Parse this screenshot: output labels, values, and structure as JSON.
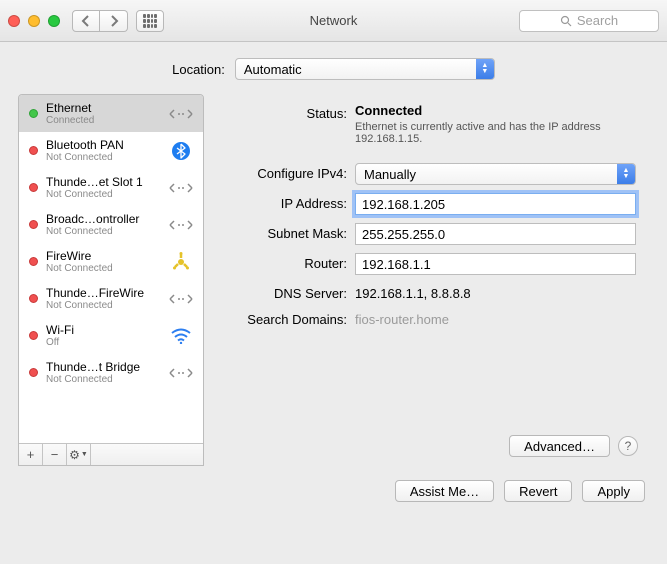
{
  "window": {
    "title": "Network",
    "search_placeholder": "Search"
  },
  "location": {
    "label": "Location:",
    "value": "Automatic"
  },
  "interfaces": [
    {
      "name": "Ethernet",
      "sub": "Connected",
      "dot": "green",
      "icon": "ethernet-icon",
      "selected": true
    },
    {
      "name": "Bluetooth PAN",
      "sub": "Not Connected",
      "dot": "red",
      "icon": "bluetooth-icon",
      "selected": false
    },
    {
      "name": "Thunde…et Slot 1",
      "sub": "Not Connected",
      "dot": "red",
      "icon": "ethernet-icon",
      "selected": false
    },
    {
      "name": "Broadc…ontroller",
      "sub": "Not Connected",
      "dot": "red",
      "icon": "ethernet-icon",
      "selected": false
    },
    {
      "name": "FireWire",
      "sub": "Not Connected",
      "dot": "red",
      "icon": "firewire-icon",
      "selected": false
    },
    {
      "name": "Thunde…FireWire",
      "sub": "Not Connected",
      "dot": "red",
      "icon": "ethernet-icon",
      "selected": false
    },
    {
      "name": "Wi-Fi",
      "sub": "Off",
      "dot": "red",
      "icon": "wifi-icon",
      "selected": false
    },
    {
      "name": "Thunde…t Bridge",
      "sub": "Not Connected",
      "dot": "red",
      "icon": "ethernet-icon",
      "selected": false
    }
  ],
  "detail": {
    "status_label": "Status:",
    "status_value": "Connected",
    "status_msg": "Ethernet is currently active and has the IP address 192.168.1.15.",
    "configure_label": "Configure IPv4:",
    "configure_value": "Manually",
    "ip_label": "IP Address:",
    "ip_value": "192.168.1.205",
    "mask_label": "Subnet Mask:",
    "mask_value": "255.255.255.0",
    "router_label": "Router:",
    "router_value": "192.168.1.1",
    "dns_label": "DNS Server:",
    "dns_value": "192.168.1.1, 8.8.8.8",
    "search_label": "Search Domains:",
    "search_value": "fios-router.home",
    "advanced_label": "Advanced…"
  },
  "buttons": {
    "assist": "Assist Me…",
    "revert": "Revert",
    "apply": "Apply"
  }
}
